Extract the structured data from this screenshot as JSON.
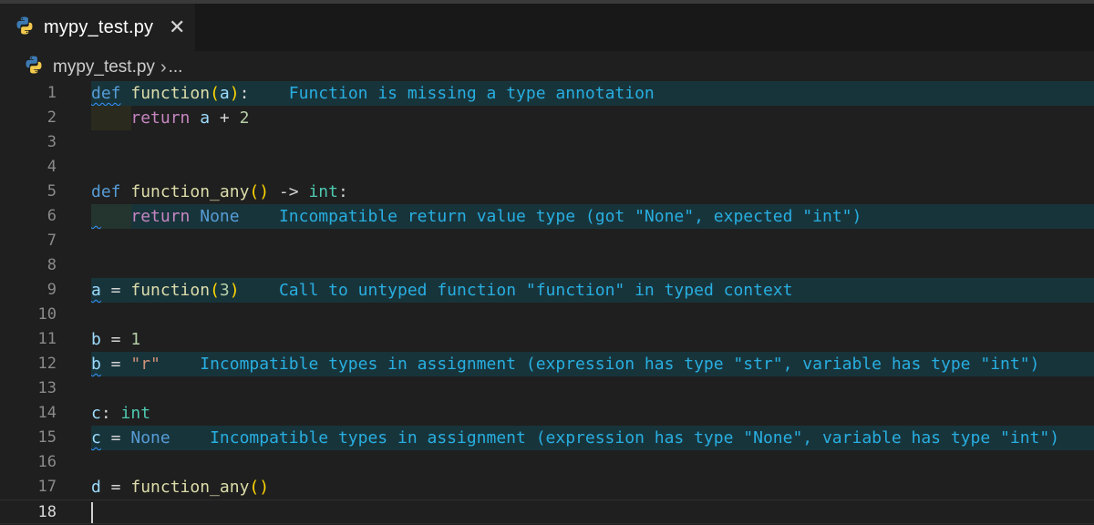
{
  "tab": {
    "filename": "mypy_test.py",
    "close_glyph": "✕"
  },
  "breadcrumb": {
    "file": "mypy_test.py",
    "separator": "›",
    "more": "..."
  },
  "line_numbers": [
    "1",
    "2",
    "3",
    "4",
    "5",
    "6",
    "7",
    "8",
    "9",
    "10",
    "11",
    "12",
    "13",
    "14",
    "15",
    "16",
    "17",
    "18"
  ],
  "code": {
    "l1": {
      "def": "def",
      "name": "function",
      "open": "(",
      "param": "a",
      "close": ")",
      "colon": ":"
    },
    "l2": {
      "ret": "return",
      "a": "a",
      "plus": " + ",
      "two": "2"
    },
    "l5": {
      "def": "def",
      "name": "function_any",
      "parens": "()",
      "arrow": " -> ",
      "type": "int",
      "colon": ":"
    },
    "l6": {
      "ret": "return",
      "none": "None"
    },
    "l9": {
      "a": "a",
      "eq": " = ",
      "name": "function",
      "open": "(",
      "three": "3",
      "close": ")"
    },
    "l11": {
      "b": "b",
      "eq": " = ",
      "one": "1"
    },
    "l12": {
      "b": "b",
      "eq": " = ",
      "str": "\"r\""
    },
    "l14": {
      "c": "c",
      "colon": ": ",
      "type": "int"
    },
    "l15": {
      "c": "c",
      "eq": " = ",
      "none": "None"
    },
    "l17": {
      "d": "d",
      "eq": " = ",
      "name": "function_any",
      "parens": "()"
    }
  },
  "diagnostics": {
    "l1": "Function is missing a type annotation",
    "l6": "Incompatible return value type (got \"None\", expected \"int\")",
    "l9": "Call to untyped function \"function\" in typed context",
    "l12": "Incompatible types in assignment (expression has type \"str\", variable has type \"int\")",
    "l15": "Incompatible types in assignment (expression has type \"None\", variable has type \"int\")"
  },
  "icons": {
    "tab": "python-icon",
    "breadcrumb": "python-icon",
    "close": "close-icon"
  },
  "colors": {
    "keyword": "#569cd6",
    "function": "#dcdcaa",
    "variable": "#9cdcfe",
    "number": "#b5cea8",
    "string": "#ce9178",
    "type": "#4ec9b0",
    "diagnostic": "#28aee0",
    "diagnostic_bg": "#18343b"
  }
}
